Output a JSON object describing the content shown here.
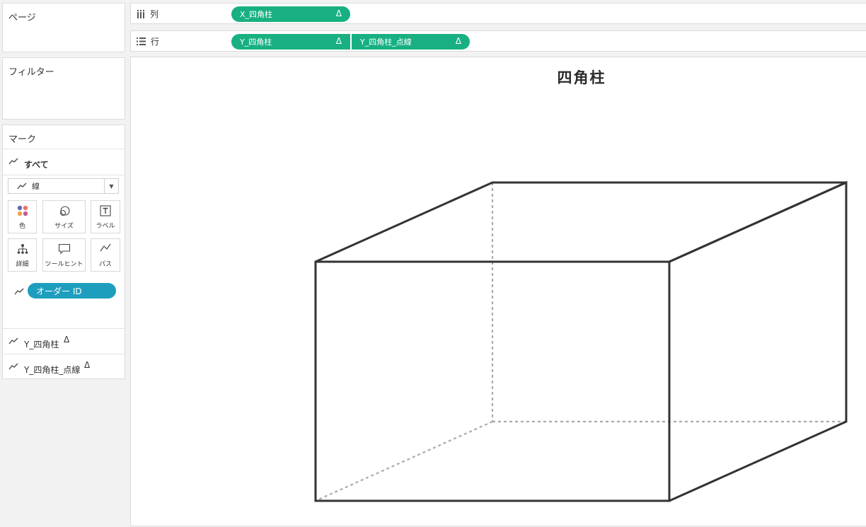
{
  "pages_card": {
    "title": "ページ"
  },
  "filters_card": {
    "title": "フィルター"
  },
  "marks_card": {
    "title": "マーク",
    "all_label": "すべて",
    "mark_type": "線",
    "buttons": {
      "color": "色",
      "size": "サイズ",
      "label": "ラベル",
      "detail": "詳細",
      "tooltip": "ツールヒント",
      "path": "パス"
    },
    "path_field": "オーダー ID",
    "colors": {
      "path_pill": "#1e9ebd"
    },
    "measures": [
      {
        "label": "Y_四角柱",
        "delta": "Δ"
      },
      {
        "label": "Y_四角柱_点線",
        "delta": "Δ"
      }
    ]
  },
  "columns_shelf": {
    "label": "列",
    "pills": [
      {
        "label": "X_四角柱",
        "delta": "Δ"
      }
    ]
  },
  "rows_shelf": {
    "label": "行",
    "pills": [
      {
        "label": "Y_四角柱",
        "delta": "Δ"
      },
      {
        "label": "Y_四角柱_点線",
        "delta": "Δ"
      }
    ]
  },
  "colors": {
    "pill_green": "#18b082",
    "solid_line": "#333333",
    "dashed_line": "#aaaaaa"
  },
  "view": {
    "title": "四角柱",
    "solid_edges_note": "front face, top face, right face drawn with solid dark lines",
    "dashed_edges_note": "hidden back edges drawn with dotted gray lines"
  }
}
